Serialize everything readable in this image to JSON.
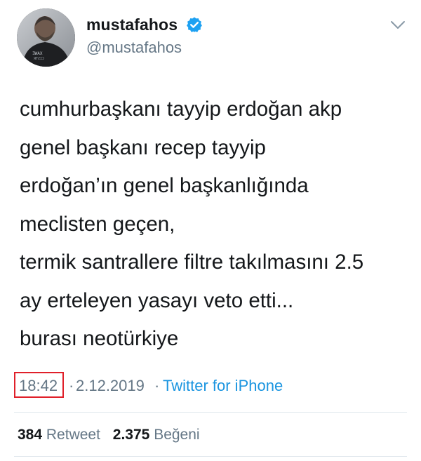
{
  "user": {
    "name": "mustafahos",
    "handle": "@mustafahos"
  },
  "icons": {
    "verified": "verified-badge-icon",
    "menu": "chevron-down-icon"
  },
  "colors": {
    "verified": "#1da1f2",
    "link": "#1b95e0",
    "secondary_text": "#657786",
    "highlight_box": "#e0202a"
  },
  "tweet": {
    "lines": [
      "cumhurbaşkanı tayyip erdoğan akp",
      "genel başkanı recep tayyip",
      "erdoğan’ın genel başkanlığında",
      "meclisten geçen,",
      "termik santrallere filtre takılmasını 2.5",
      "ay erteleyen yasayı veto etti...",
      "burası neotürkiye"
    ]
  },
  "meta": {
    "time": "18:42",
    "separator": "·",
    "date": "2.12.2019",
    "source": "Twitter for iPhone"
  },
  "stats": {
    "retweets_count": "384",
    "retweets_label": "Retweet",
    "likes_count": "2.375",
    "likes_label": "Beğeni"
  }
}
